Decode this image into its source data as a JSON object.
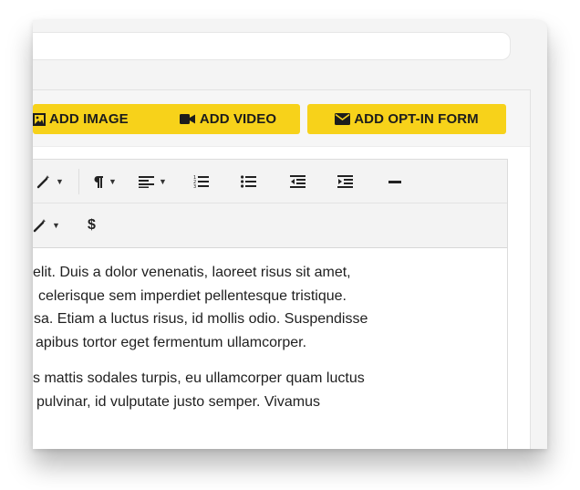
{
  "buttons": {
    "add_image": "ADD IMAGE",
    "add_video": "ADD VIDEO",
    "add_optin": "ADD OPT-IN FORM"
  },
  "toolbar": {
    "row1": [
      "magic-wand-icon",
      "paragraph-icon",
      "align-icon",
      "ordered-list-icon",
      "unordered-list-icon",
      "outdent-icon",
      "indent-icon",
      "horizontal-rule-icon"
    ],
    "row2": [
      "magic-wand-icon",
      "dollar-icon"
    ],
    "dollar_label": "$"
  },
  "content": {
    "paragraph1": [
      "elit. Duis a dolor venenatis, laoreet risus sit amet,",
      "celerisque sem imperdiet pellentesque tristique.",
      "sa. Etiam a luctus risus, id mollis odio. Suspendisse",
      "apibus tortor eget fermentum ullamcorper."
    ],
    "paragraph2": [
      "s mattis sodales turpis, eu ullamcorper quam luctus",
      "pulvinar, id vulputate justo semper. Vivamus"
    ]
  },
  "colors": {
    "button_bg": "#f7d21a",
    "button_text": "#1c1c1c",
    "toolbar_bg": "#f3f3f3"
  }
}
